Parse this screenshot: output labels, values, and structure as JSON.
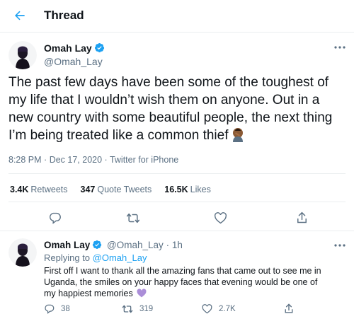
{
  "header": {
    "title": "Thread"
  },
  "main_tweet": {
    "author_name": "Omah Lay",
    "author_handle": "@Omah_Lay",
    "text": "The past few days have been some of the toughest of my life that I wouldn’t wish them on anyone. Out in a new country with some beautiful people, the next thing I’m being treated like a common thief",
    "emoji": "facepalm-emoji",
    "time": "8:28 PM",
    "date": "Dec 17, 2020",
    "source": "Twitter for iPhone",
    "stats": {
      "retweets_count": "3.4K",
      "retweets_label": "Retweets",
      "quote_count": "347",
      "quote_label": "Quote Tweets",
      "likes_count": "16.5K",
      "likes_label": "Likes"
    }
  },
  "reply_tweet": {
    "author_name": "Omah Lay",
    "author_handle": "@Omah_Lay",
    "age": "1h",
    "replying_label": "Replying to",
    "replying_handle": "@Omah_Lay",
    "text": "First off I want to thank all the amazing fans that came out to see me in Uganda, the smiles on your happy faces that evening would be one of my happiest memories",
    "emoji": "purple-heart-emoji",
    "replies": "38",
    "retweets": "319",
    "likes": "2.7K"
  },
  "colors": {
    "accent": "#1da1f2",
    "secondary_text": "#5b7083",
    "divider": "#ebeef0",
    "heart": "#ab8ed8"
  }
}
